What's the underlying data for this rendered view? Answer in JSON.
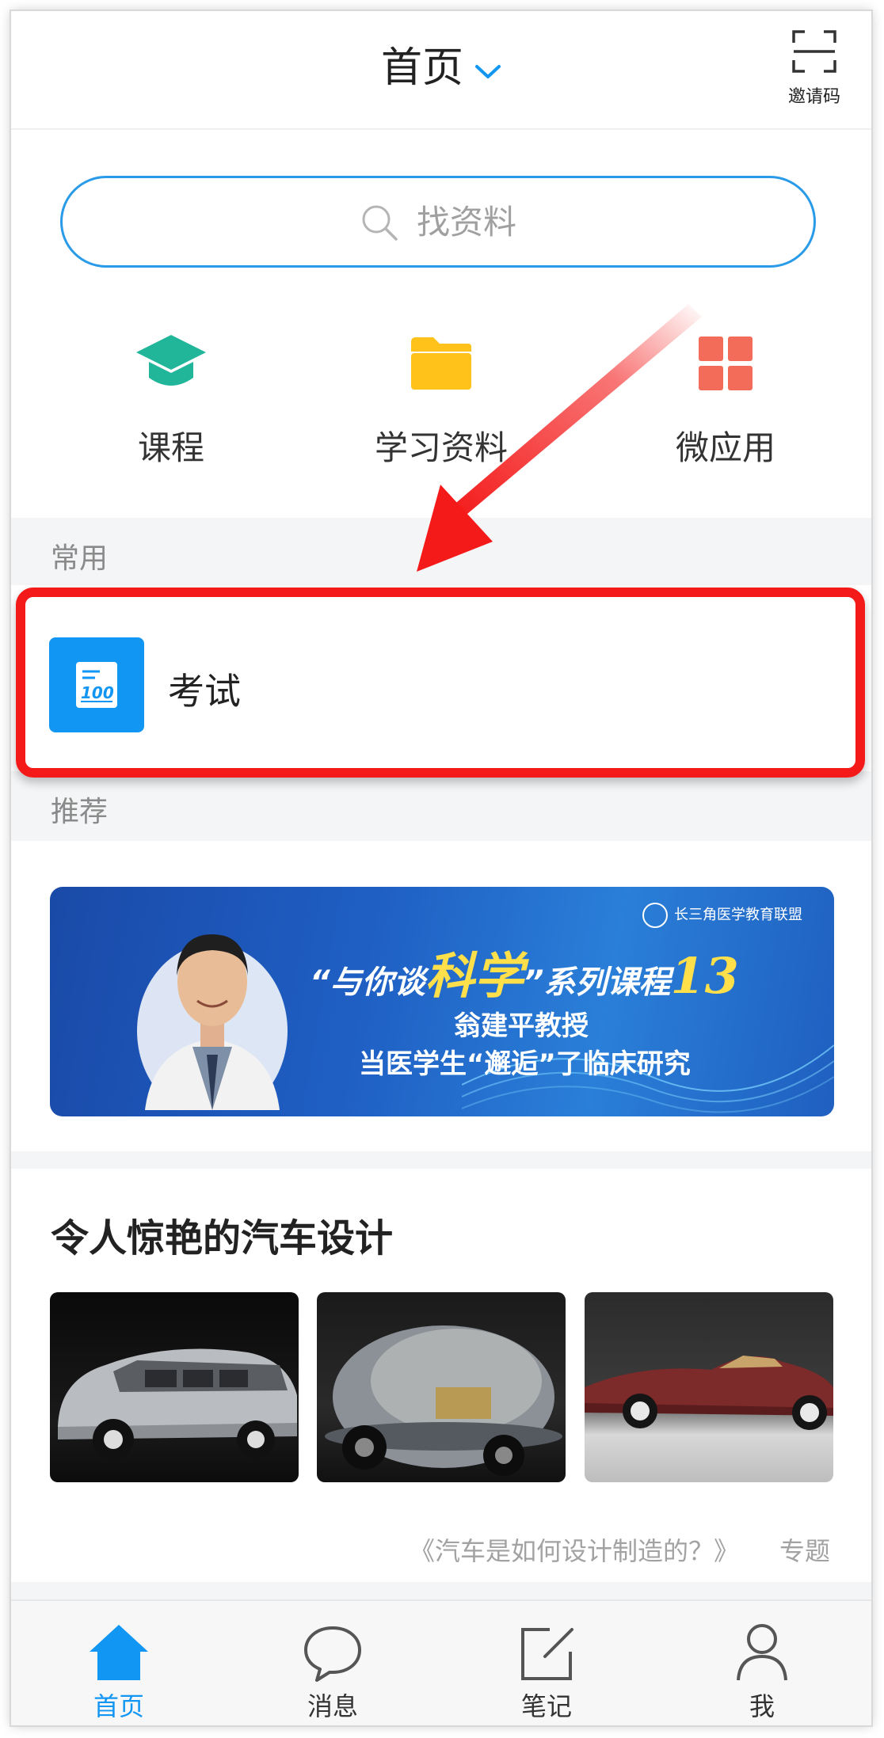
{
  "header": {
    "title": "首页",
    "invite_label": "邀请码"
  },
  "search": {
    "placeholder": "找资料"
  },
  "quick_actions": [
    {
      "label": "课程",
      "icon": "graduation-cap-icon",
      "color": "#21b59a"
    },
    {
      "label": "学习资料",
      "icon": "folder-icon",
      "color": "#ffc21a"
    },
    {
      "label": "微应用",
      "icon": "grid-apps-icon",
      "color": "#f36c5a"
    }
  ],
  "common": {
    "title": "常用",
    "items": [
      {
        "label": "考试",
        "icon": "exam-100-icon",
        "color": "#1296f3"
      }
    ]
  },
  "recommend": {
    "title": "推荐",
    "banner": {
      "org": "长三角医学教育联盟",
      "line1_a": "“与你谈",
      "line1_b": "科学",
      "line1_c": "”系列课程",
      "line1_num": "13",
      "line2": "翁建平教授",
      "line3": "当医学生“邂逅”了临床研究"
    }
  },
  "feature": {
    "title": "令人惊艳的汽车设计",
    "caption": "《汽车是如何设计制造的？》",
    "tag": "专题"
  },
  "tabs": [
    {
      "label": "首页",
      "icon": "home-icon",
      "active": true
    },
    {
      "label": "消息",
      "icon": "chat-bubble-icon",
      "active": false
    },
    {
      "label": "笔记",
      "icon": "note-edit-icon",
      "active": false
    },
    {
      "label": "我",
      "icon": "person-icon",
      "active": false
    }
  ],
  "colors": {
    "accent": "#1296f3",
    "highlight": "#f41a1a"
  }
}
